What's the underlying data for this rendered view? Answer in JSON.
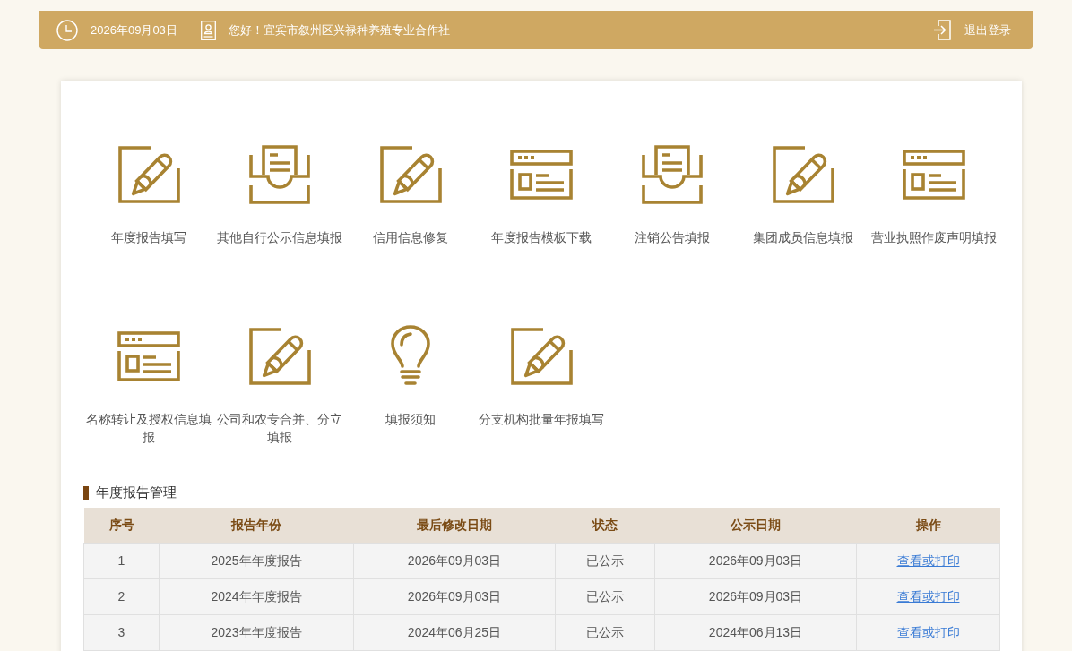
{
  "header": {
    "date": "2026年09月03日",
    "greeting": "您好！宜宾市叙州区兴禄种养殖专业合作社",
    "logout": "退出登录"
  },
  "menu": [
    {
      "label": "年度报告填写",
      "kind": "edit"
    },
    {
      "label": "其他自行公示信息填报",
      "kind": "inbox"
    },
    {
      "label": "信用信息修复",
      "kind": "edit"
    },
    {
      "label": "年度报告模板下载",
      "kind": "template"
    },
    {
      "label": "注销公告填报",
      "kind": "inbox"
    },
    {
      "label": "集团成员信息填报",
      "kind": "edit"
    },
    {
      "label": "营业执照作废声明填报",
      "kind": "template"
    },
    {
      "label": "名称转让及授权信息填报",
      "kind": "template"
    },
    {
      "label": "公司和农专合并、分立填报",
      "kind": "edit"
    },
    {
      "label": "填报须知",
      "kind": "bulb"
    },
    {
      "label": "分支机构批量年报填写",
      "kind": "edit"
    }
  ],
  "section": {
    "title": "年度报告管理"
  },
  "table": {
    "columns": [
      "序号",
      "报告年份",
      "最后修改日期",
      "状态",
      "公示日期",
      "操作"
    ],
    "rows": [
      [
        "1",
        "2025年年度报告",
        "2026年09月03日",
        "已公示",
        "2026年09月03日",
        "查看或打印"
      ],
      [
        "2",
        "2024年年度报告",
        "2026年09月03日",
        "已公示",
        "2026年09月03日",
        "查看或打印"
      ],
      [
        "3",
        "2023年年度报告",
        "2024年06月25日",
        "已公示",
        "2024年06月13日",
        "查看或打印"
      ]
    ]
  }
}
